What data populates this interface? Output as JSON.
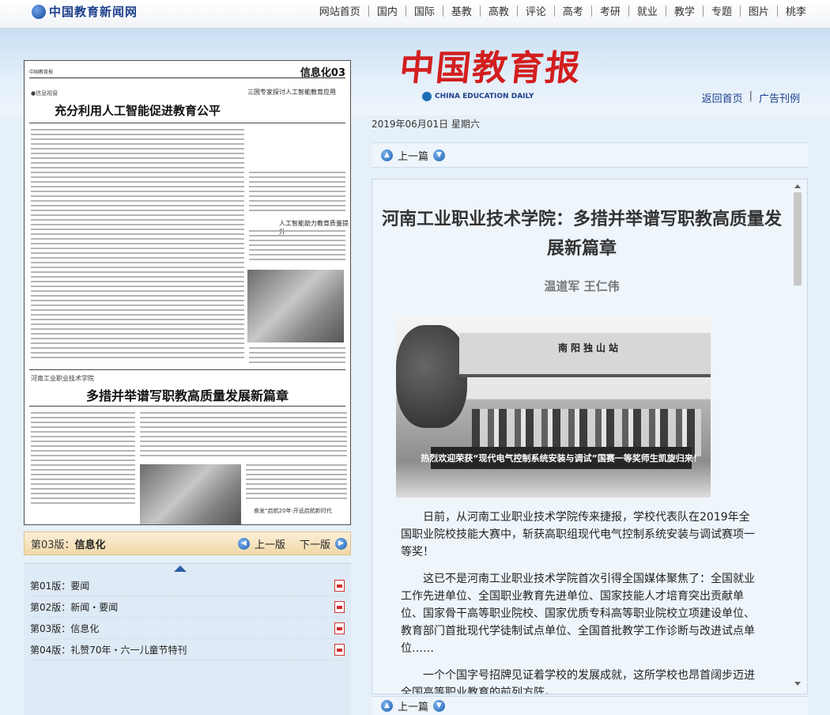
{
  "site": {
    "name": "中国教育新闻网"
  },
  "nav": {
    "items": [
      "网站首页",
      "国内",
      "国际",
      "基教",
      "高教",
      "评论",
      "高考",
      "考研",
      "就业",
      "教学",
      "专题",
      "图片",
      "桃李"
    ]
  },
  "header": {
    "paper_name": "中国教育报",
    "paper_name_en": "CHINA EDUCATION DAILY",
    "links": {
      "home": "返回首页",
      "ads": "广告刊例"
    }
  },
  "thumbnail": {
    "section": "信息化03",
    "masthead": "中国教育报",
    "tag1": "●信息视窗",
    "headline1": "充分利用人工智能促进教育公平",
    "sub1": "三国专家探讨人工智能教育应用",
    "sub2": "人工智能助力教育质量提升",
    "tag2": "河南工业职业技术学院",
    "headline2": "多措并举谱写职教高质量发展新篇章",
    "bottom": "奋发“启航20年·开远启航新时代"
  },
  "pager": {
    "label": "第03版：",
    "value": "信息化",
    "prev": "上一版",
    "next": "下一版"
  },
  "page_list": [
    {
      "label": "第01版：要闻"
    },
    {
      "label": "第02版：新闻・要闻"
    },
    {
      "label": "第03版：信息化"
    },
    {
      "label": "第04版：礼赞70年・六一儿童节特刊"
    }
  ],
  "article": {
    "date": "2019年06月01日  星期六",
    "prev_label": "上一篇",
    "title": "河南工业职业技术学院：多措并举谱写职教高质量发展新篇章",
    "author": "温道军  王仁伟",
    "photo": {
      "sign": "南阳独山站",
      "banner": "热烈欢迎荣获“现代电气控制系统安装与调试”国赛一等奖师生凯旋归来！"
    },
    "paragraphs": [
      "日前，从河南工业职业技术学院传来捷报，学校代表队在2019年全国职业院校技能大赛中，斩获高职组现代电气控制系统安装与调试赛项一等奖！",
      "这已不是河南工业职业技术学院首次引得全国媒体聚焦了：全国就业工作先进单位、全国职业教育先进单位、国家技能人才培育突出贡献单位、国家骨干高等职业院校、国家优质专科高等职业院校立项建设单位、教育部门首批现代学徒制试点单位、全国首批教学工作诊断与改进试点单位……",
      "一个个国字号招牌见证着学校的发展成就，这所学校也昂首阔步迈进全国高等职业教育的前列方阵。"
    ]
  }
}
